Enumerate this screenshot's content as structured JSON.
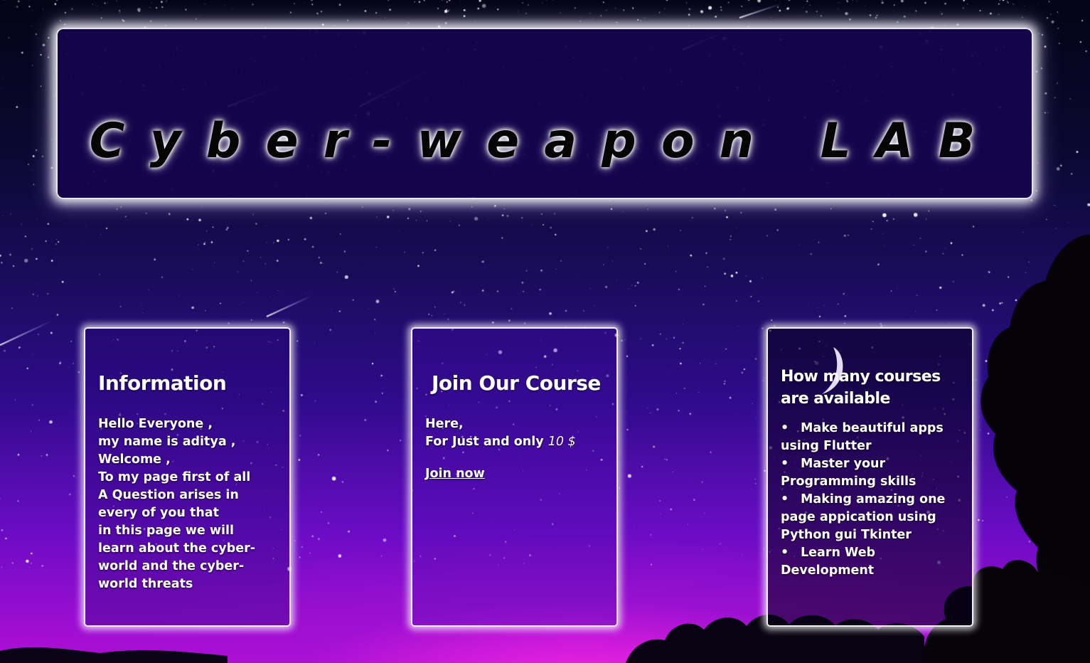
{
  "banner": {
    "title": "Cyber-weapon LAB"
  },
  "cards": {
    "information": {
      "title": "Information",
      "lines": [
        "Hello Everyone ,",
        "my name is aditya ,",
        "Welcome ,",
        "To my page first of all",
        "A Question arises in",
        "every of you that",
        "in this page we will",
        "learn about the cyber-",
        "world and the cyber-",
        "world threats"
      ]
    },
    "join": {
      "title": "Join Our Course",
      "line1": "Here,",
      "line2_prefix": "For Just and only ",
      "price": "10 $",
      "link": "Join now"
    },
    "courses": {
      "title": "How many courses are available",
      "items": [
        "Make beautiful apps using Flutter",
        "Master your Programming skills",
        "Making amazing one page appication using Python gui Tkinter",
        "Learn Web Development"
      ]
    }
  },
  "colors": {
    "banner_bg": "#16044e",
    "title_text": "#050505",
    "card_border": "#ffffff",
    "link": "#ffffff"
  }
}
